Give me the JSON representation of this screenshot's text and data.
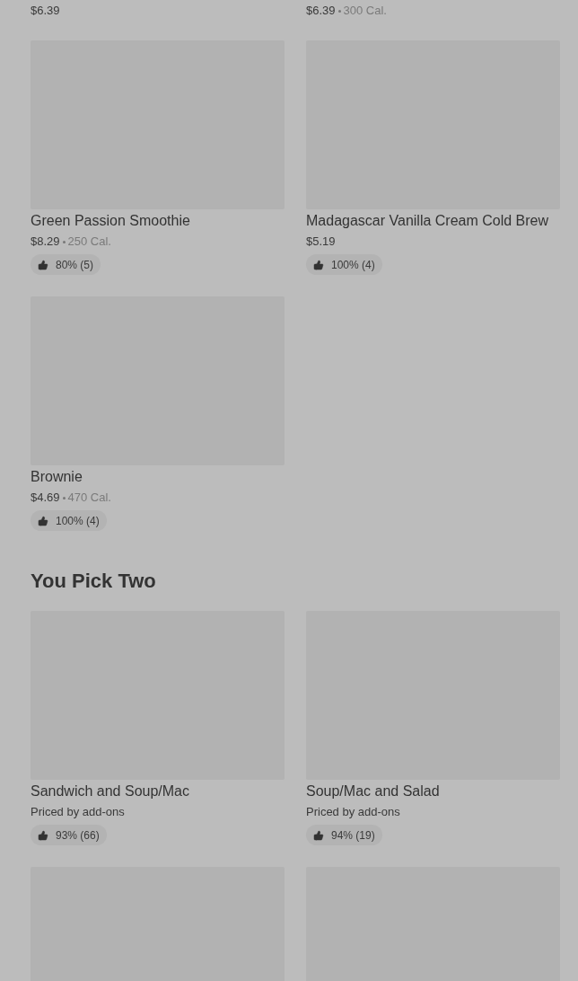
{
  "sections": [
    {
      "items": [
        {
          "kind": "price_only",
          "price": "$6.39"
        },
        {
          "kind": "price_only",
          "price": "$6.39",
          "calories": "300 Cal."
        },
        {
          "kind": "full",
          "name": "Green Passion Smoothie",
          "price": "$8.29",
          "calories": "250 Cal.",
          "rating": "80% (5)"
        },
        {
          "kind": "full",
          "name": "Madagascar Vanilla Cream Cold Brew",
          "price": "$5.19",
          "rating": "100% (4)"
        },
        {
          "kind": "full",
          "name": "Brownie",
          "price": "$4.69",
          "calories": "470 Cal.",
          "rating": "100% (4)"
        }
      ]
    },
    {
      "title": "You Pick Two",
      "items": [
        {
          "kind": "full",
          "name": "Sandwich and Soup/Mac",
          "price": "Priced by add-ons",
          "rating": "93% (66)"
        },
        {
          "kind": "full",
          "name": "Soup/Mac and Salad",
          "price": "Priced by add-ons",
          "rating": "94% (19)"
        },
        {
          "kind": "image_only"
        },
        {
          "kind": "image_only"
        }
      ]
    }
  ]
}
